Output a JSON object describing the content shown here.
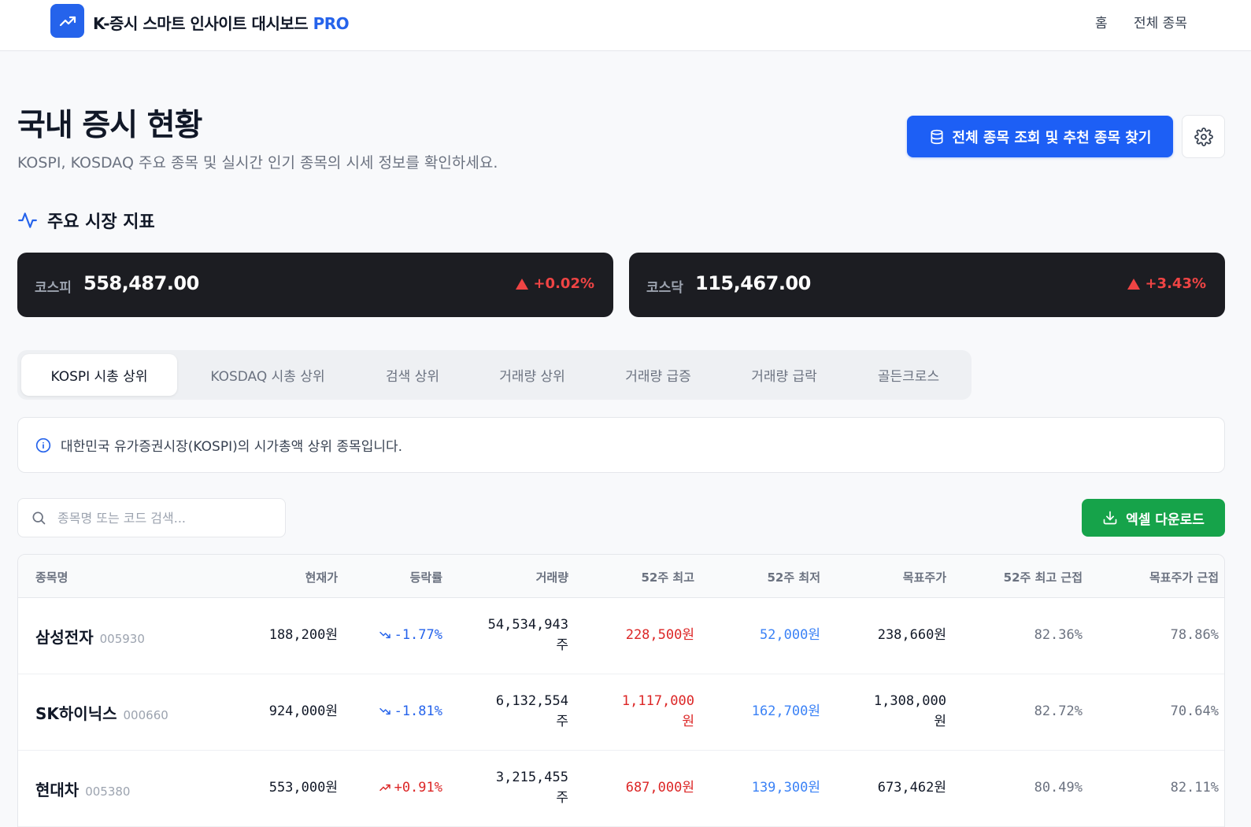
{
  "header": {
    "brand": "K-증시 스마트 인사이트 대시보드",
    "brand_suffix": "PRO",
    "nav_home": "홈",
    "nav_all": "전체 종목"
  },
  "page": {
    "title": "국내 증시 현황",
    "subtitle": "KOSPI, KOSDAQ 주요 종목 및 실시간 인기 종목의 시세 정보를 확인하세요.",
    "primary_button": "전체 종목 조회 및 추천 종목 찾기",
    "section_title": "주요 시장 지표"
  },
  "markets": [
    {
      "label": "코스피",
      "value": "558,487.00",
      "change": "+0.02%"
    },
    {
      "label": "코스닥",
      "value": "115,467.00",
      "change": "+3.43%"
    }
  ],
  "tabs": [
    "KOSPI 시총 상위",
    "KOSDAQ 시총 상위",
    "검색 상위",
    "거래량 상위",
    "거래량 급증",
    "거래량 급락",
    "골든크로스"
  ],
  "info_text": "대한민국 유가증권시장(KOSPI)의 시가총액 상위 종목입니다.",
  "search": {
    "placeholder": "종목명 또는 코드 검색..."
  },
  "download_button": "엑셀 다운로드",
  "table": {
    "headers": [
      "종목명",
      "현재가",
      "등락률",
      "거래량",
      "52주 최고",
      "52주 최저",
      "목표주가",
      "52주 최고 근접",
      "목표주가 근접"
    ],
    "rows": [
      {
        "name": "삼성전자",
        "code": "005930",
        "price": "188,200원",
        "change": "-1.77%",
        "volume": "54,534,943",
        "volume_unit": "주",
        "high": "228,500원",
        "high_unit": "",
        "low": "52,000원",
        "target": "238,660원",
        "target_unit": "",
        "near_high": "82.36%",
        "near_target": "78.86%"
      },
      {
        "name": "SK하이닉스",
        "code": "000660",
        "price": "924,000원",
        "change": "-1.81%",
        "volume": "6,132,554",
        "volume_unit": "주",
        "high": "1,117,000",
        "high_unit": "원",
        "low": "162,700원",
        "target": "1,308,000",
        "target_unit": "원",
        "near_high": "82.72%",
        "near_target": "70.64%"
      },
      {
        "name": "현대차",
        "code": "005380",
        "price": "553,000원",
        "change": "+0.91%",
        "volume": "3,215,455",
        "volume_unit": "주",
        "high": "687,000원",
        "high_unit": "",
        "low": "139,300원",
        "target": "673,462원",
        "target_unit": "",
        "near_high": "80.49%",
        "near_target": "82.11%"
      }
    ]
  },
  "colors": {
    "primary": "#1d5ff5",
    "positive": "#dc2626",
    "negative": "#2563eb",
    "download": "#16a34a",
    "card": "#1c1d22"
  }
}
